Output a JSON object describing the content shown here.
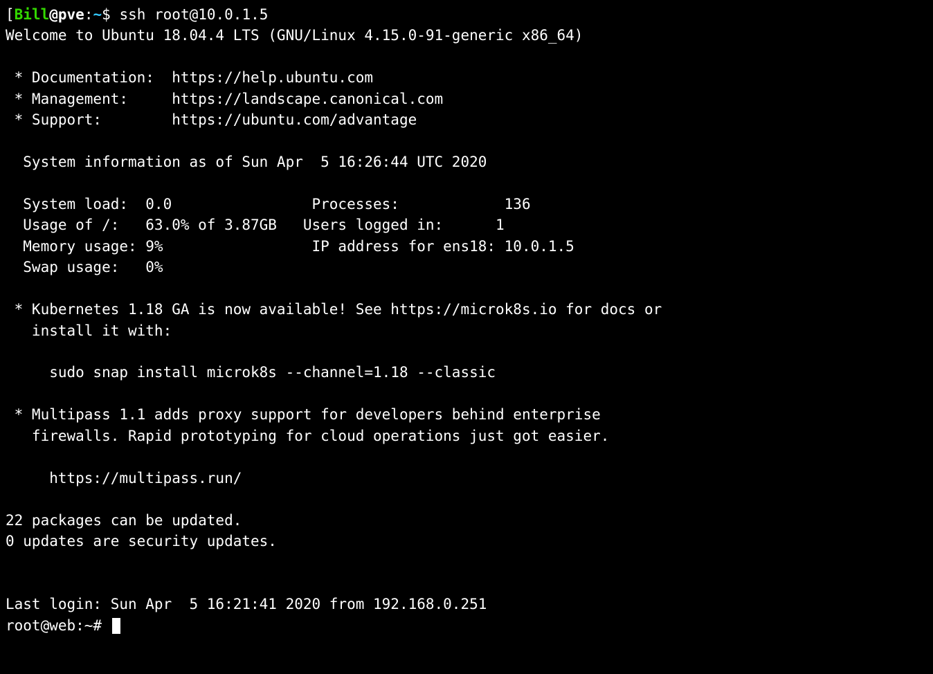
{
  "prompt1": {
    "bracket_open": "[",
    "user": "Bill",
    "at": "@",
    "host": "pve",
    "colon": ":",
    "cwd": "~",
    "sigil": "$ ",
    "cmd": "ssh root@10.0.1.5"
  },
  "welcome": "Welcome to Ubuntu 18.04.4 LTS (GNU/Linux 4.15.0-91-generic x86_64)",
  "links": {
    "doc": " * Documentation:  https://help.ubuntu.com",
    "mgmt": " * Management:     https://landscape.canonical.com",
    "support": " * Support:        https://ubuntu.com/advantage"
  },
  "sysinfo_header": "  System information as of Sun Apr  5 16:26:44 UTC 2020",
  "sysinfo": {
    "row1": "  System load:  0.0                Processes:            136",
    "row2": "  Usage of /:   63.0% of 3.87GB   Users logged in:      1",
    "row3": "  Memory usage: 9%                 IP address for ens18: 10.0.1.5",
    "row4": "  Swap usage:   0%"
  },
  "k8s": {
    "l1": " * Kubernetes 1.18 GA is now available! See https://microk8s.io for docs or",
    "l2": "   install it with:",
    "l3": "     sudo snap install microk8s --channel=1.18 --classic"
  },
  "multipass": {
    "l1": " * Multipass 1.1 adds proxy support for developers behind enterprise",
    "l2": "   firewalls. Rapid prototyping for cloud operations just got easier.",
    "l3": "     https://multipass.run/"
  },
  "updates": {
    "pkgs": "22 packages can be updated.",
    "sec": "0 updates are security updates."
  },
  "last_login": "Last login: Sun Apr  5 16:21:41 2020 from 192.168.0.251",
  "prompt2": "root@web:~# "
}
